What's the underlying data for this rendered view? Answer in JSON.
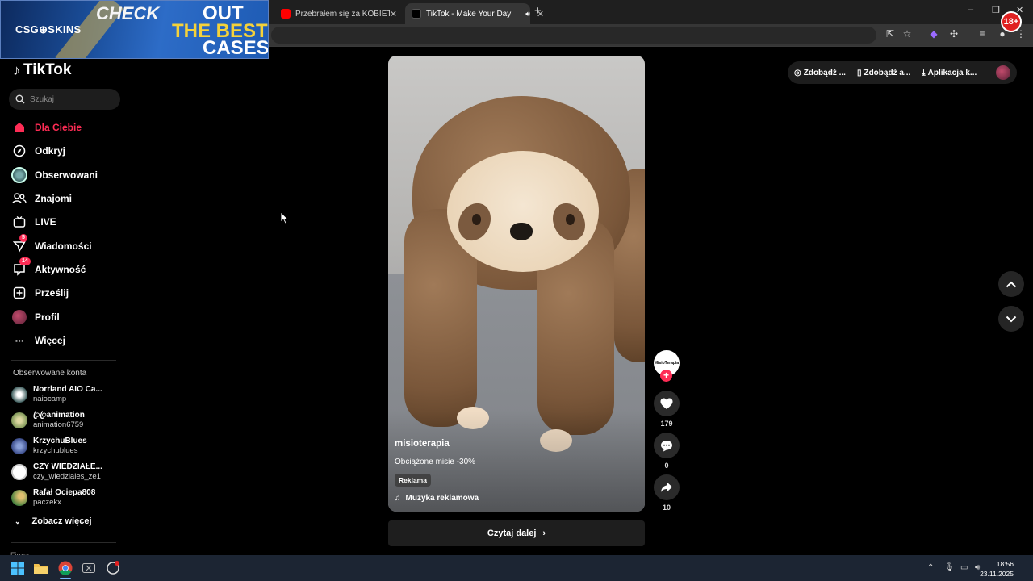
{
  "browser": {
    "tabs": [
      {
        "title": "Przebrałem się za KOBIETĘ na S",
        "active": false
      },
      {
        "title": "TikTok - Make Your Day",
        "active": true
      }
    ],
    "window_controls": {
      "minimize": "–",
      "maximize": "❐",
      "close": "✕"
    }
  },
  "ad_banner": {
    "logo": "CSG⊕SKINS",
    "check": "CHECK",
    "out": "OUT",
    "the_best": "THE BEST",
    "cases": "CASES",
    "age_badge": "18+"
  },
  "tiktok": {
    "logo_text": "TikTok",
    "search_placeholder": "Szukaj",
    "nav": [
      {
        "label": "Dla Ciebie",
        "icon": "home-icon",
        "active": true
      },
      {
        "label": "Odkryj",
        "icon": "compass-icon"
      },
      {
        "label": "Obserwowani",
        "icon": "following-avatar-icon"
      },
      {
        "label": "Znajomi",
        "icon": "friends-icon"
      },
      {
        "label": "LIVE",
        "icon": "live-icon"
      },
      {
        "label": "Wiadomości",
        "icon": "send-icon",
        "badge": "5"
      },
      {
        "label": "Aktywność",
        "icon": "activity-icon",
        "badge": "14"
      },
      {
        "label": "Prześlij",
        "icon": "upload-icon"
      },
      {
        "label": "Profil",
        "icon": "profile-avatar-icon"
      },
      {
        "label": "Więcej",
        "icon": "more-dots-icon"
      }
    ],
    "followed_title": "Obserwowane konta",
    "followed": [
      {
        "name": "Norrland AIO Ca...",
        "handle": "naiocamp"
      },
      {
        "name": "ꦿꦿanimation",
        "handle": "animation6759"
      },
      {
        "name": "KrzychuBlues",
        "handle": "krzychublues"
      },
      {
        "name": "CZY WIEDZIAŁE...",
        "handle": "czy_wiedziales_ze1"
      },
      {
        "name": "Rafał Ociepa808",
        "handle": "paczekx"
      }
    ],
    "see_more": "Zobacz więcej",
    "footer_cut": "Firma",
    "top_pills": [
      {
        "label": "Zdobądź ...",
        "icon": "coin-icon"
      },
      {
        "label": "Zdobądź a...",
        "icon": "phone-icon"
      },
      {
        "label": "Aplikacja k...",
        "icon": "download-icon"
      }
    ]
  },
  "video": {
    "author": "misioterapia",
    "description": "Obciążone misie -30%",
    "tag": "Reklama",
    "music": "Muzyka reklamowa",
    "read_more": "Czytaj dalej",
    "creator_avatar_text": "MisioTerapia",
    "likes": "179",
    "comments": "0",
    "shares": "10"
  },
  "taskbar": {
    "time": "18:56",
    "date": "23.11.2025"
  },
  "colors": {
    "accent": "#fe2c55",
    "background": "#000000",
    "taskbar": "#1c2533"
  }
}
